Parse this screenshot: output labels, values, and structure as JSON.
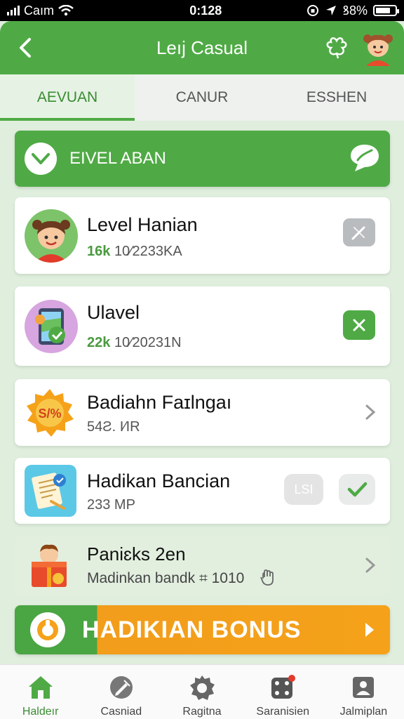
{
  "status_bar": {
    "carrier": "Caım",
    "time": "0:128",
    "battery": "ꝸ8%",
    "battery_level": 0.78
  },
  "header": {
    "title": "Leıj Casual",
    "back_icon": "chevron-left-icon",
    "action_icon": "clover-icon",
    "avatar_icon": "girl-avatar"
  },
  "tabs": [
    {
      "label": "AEVUAN",
      "active": true
    },
    {
      "label": "CANUR",
      "active": false
    },
    {
      "label": "ESSHEN",
      "active": false
    }
  ],
  "banner": {
    "title": "EIVEL ABAN",
    "badge_icon": "check-badge-icon",
    "chat_icon": "chat-bubble-icon"
  },
  "items": [
    {
      "title": "Level Hanian",
      "count": "16k",
      "meta": "10⁄2233KA",
      "icon": "girl-avatar",
      "action": "edit-icon"
    },
    {
      "title": "Ulavel",
      "count": "22k",
      "meta": "10⁄20231N",
      "icon": "phone-map-icon",
      "action": "close-icon"
    },
    {
      "title": "Badiahn Faɪlngaı",
      "meta": "54Ƨ. I⁄IR",
      "icon": "sale-badge-icon",
      "action": "chevron-right-icon"
    },
    {
      "title": "Hadikan Bancian",
      "meta": "233 MP",
      "icon": "document-icon",
      "action_label": "LSI",
      "action": "check-icon"
    },
    {
      "title": "Paniɛks 2en",
      "meta": "Madinkan bandk",
      "meta_extra": "⌗ 1010",
      "icon": "gift-box-icon",
      "action": "chevron-right-icon"
    }
  ],
  "bonus": {
    "label": "HADIKIAN BONUS",
    "coin_icon": "coin-icon",
    "arrow_icon": "play-arrow-icon"
  },
  "bottom_nav": [
    {
      "label": "Haldeır",
      "icon": "home-icon",
      "active": true
    },
    {
      "label": "Casniad",
      "icon": "pen-icon",
      "active": false
    },
    {
      "label": "Ragitna",
      "icon": "gear-icon",
      "active": false
    },
    {
      "label": "Saranisien",
      "icon": "dice-icon",
      "active": false
    },
    {
      "label": "Jalmiplan",
      "icon": "profile-card-icon",
      "active": false
    }
  ],
  "colors": {
    "primary": "#4faa45",
    "accent": "#f5a21a",
    "background": "#dfeedd"
  }
}
